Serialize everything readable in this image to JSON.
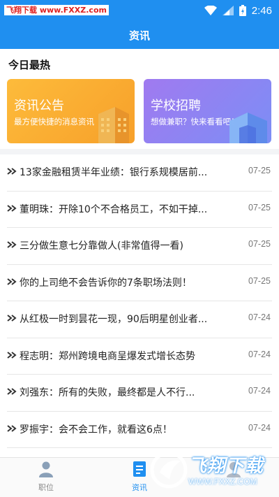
{
  "status_bar": {
    "watermark": "飞翔下载 www.FXXZ.com",
    "time": "2:46"
  },
  "header": {
    "title": "资讯"
  },
  "section": {
    "title": "今日最热"
  },
  "cards": [
    {
      "title": "资讯公告",
      "subtitle": "最方便快捷的消息资讯"
    },
    {
      "title": "学校招聘",
      "subtitle": "想做兼职？快来看看吧！"
    }
  ],
  "news": [
    {
      "title": "13家金融租赁半年业绩：银行系规模居前...",
      "date": "07-25"
    },
    {
      "title": "董明珠：开除10个不合格员工，不如干掉...",
      "date": "07-25"
    },
    {
      "title": "三分做生意七分靠做人(非常值得一看)",
      "date": "07-25"
    },
    {
      "title": "你的上司绝不会告诉你的7条职场法则！",
      "date": "07-25"
    },
    {
      "title": "从红极一时到昙花一现，90后明星创业者...",
      "date": "07-24"
    },
    {
      "title": "程志明：郑州跨境电商呈爆发式增长态势",
      "date": "07-24"
    },
    {
      "title": "刘强东：所有的失败，最终都是人不行...",
      "date": "07-24"
    },
    {
      "title": "罗振宇：会不会工作，就看这6点！",
      "date": "07-24"
    }
  ],
  "tabs": [
    {
      "label": "职位",
      "icon": "person-icon"
    },
    {
      "label": "资讯",
      "icon": "document-icon"
    },
    {
      "label": "",
      "icon": "profile-icon"
    }
  ],
  "watermark_logo": {
    "text": "飞翔下载",
    "url": "WWW.FXXZ.COM"
  },
  "colors": {
    "primary": "#1f8ff0",
    "card_orange": "#f7a02a",
    "card_purple": "#8b7ef3"
  }
}
